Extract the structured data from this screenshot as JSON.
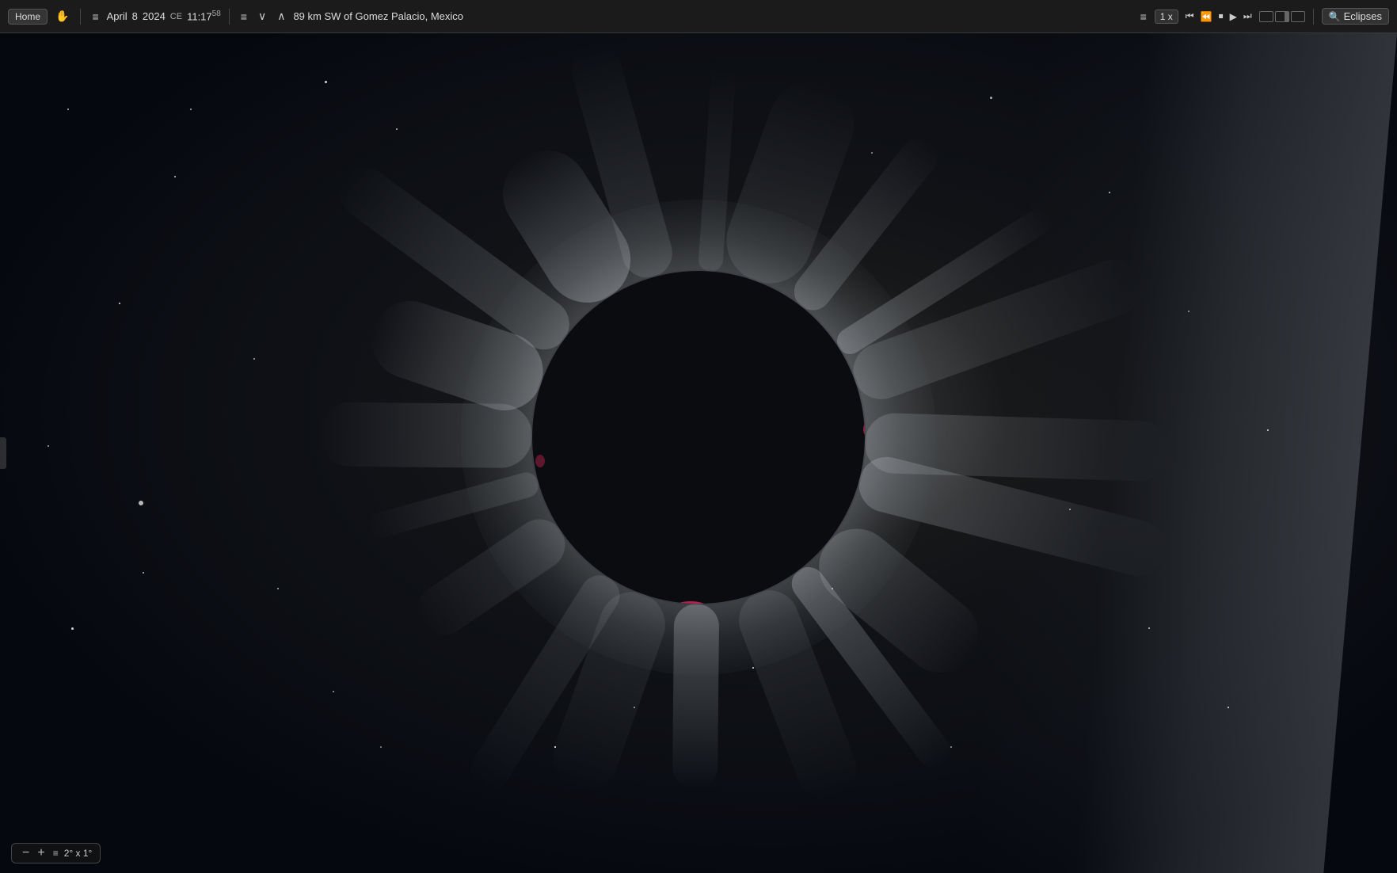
{
  "toolbar": {
    "home_label": "Home",
    "month": "April",
    "day": "8",
    "year": "2024",
    "era": "CE",
    "time": "11:17",
    "seconds": "58",
    "location": "89 km SW of Gomez Palacio, Mexico",
    "zoom": "1 x",
    "eclipses_label": "Eclipses",
    "fov": "2° x 1°",
    "menu_icon": "≡",
    "chevrons": "∨ ∧",
    "hand_cursor": "✋"
  },
  "bottom_bar": {
    "minus": "−",
    "plus": "+",
    "menu": "≡",
    "fov_label": "2° x 1°"
  },
  "scene": {
    "background_color": "#080c14",
    "corona_color": "rgba(200,205,210,0.4)",
    "moon_color": "#080b10"
  }
}
